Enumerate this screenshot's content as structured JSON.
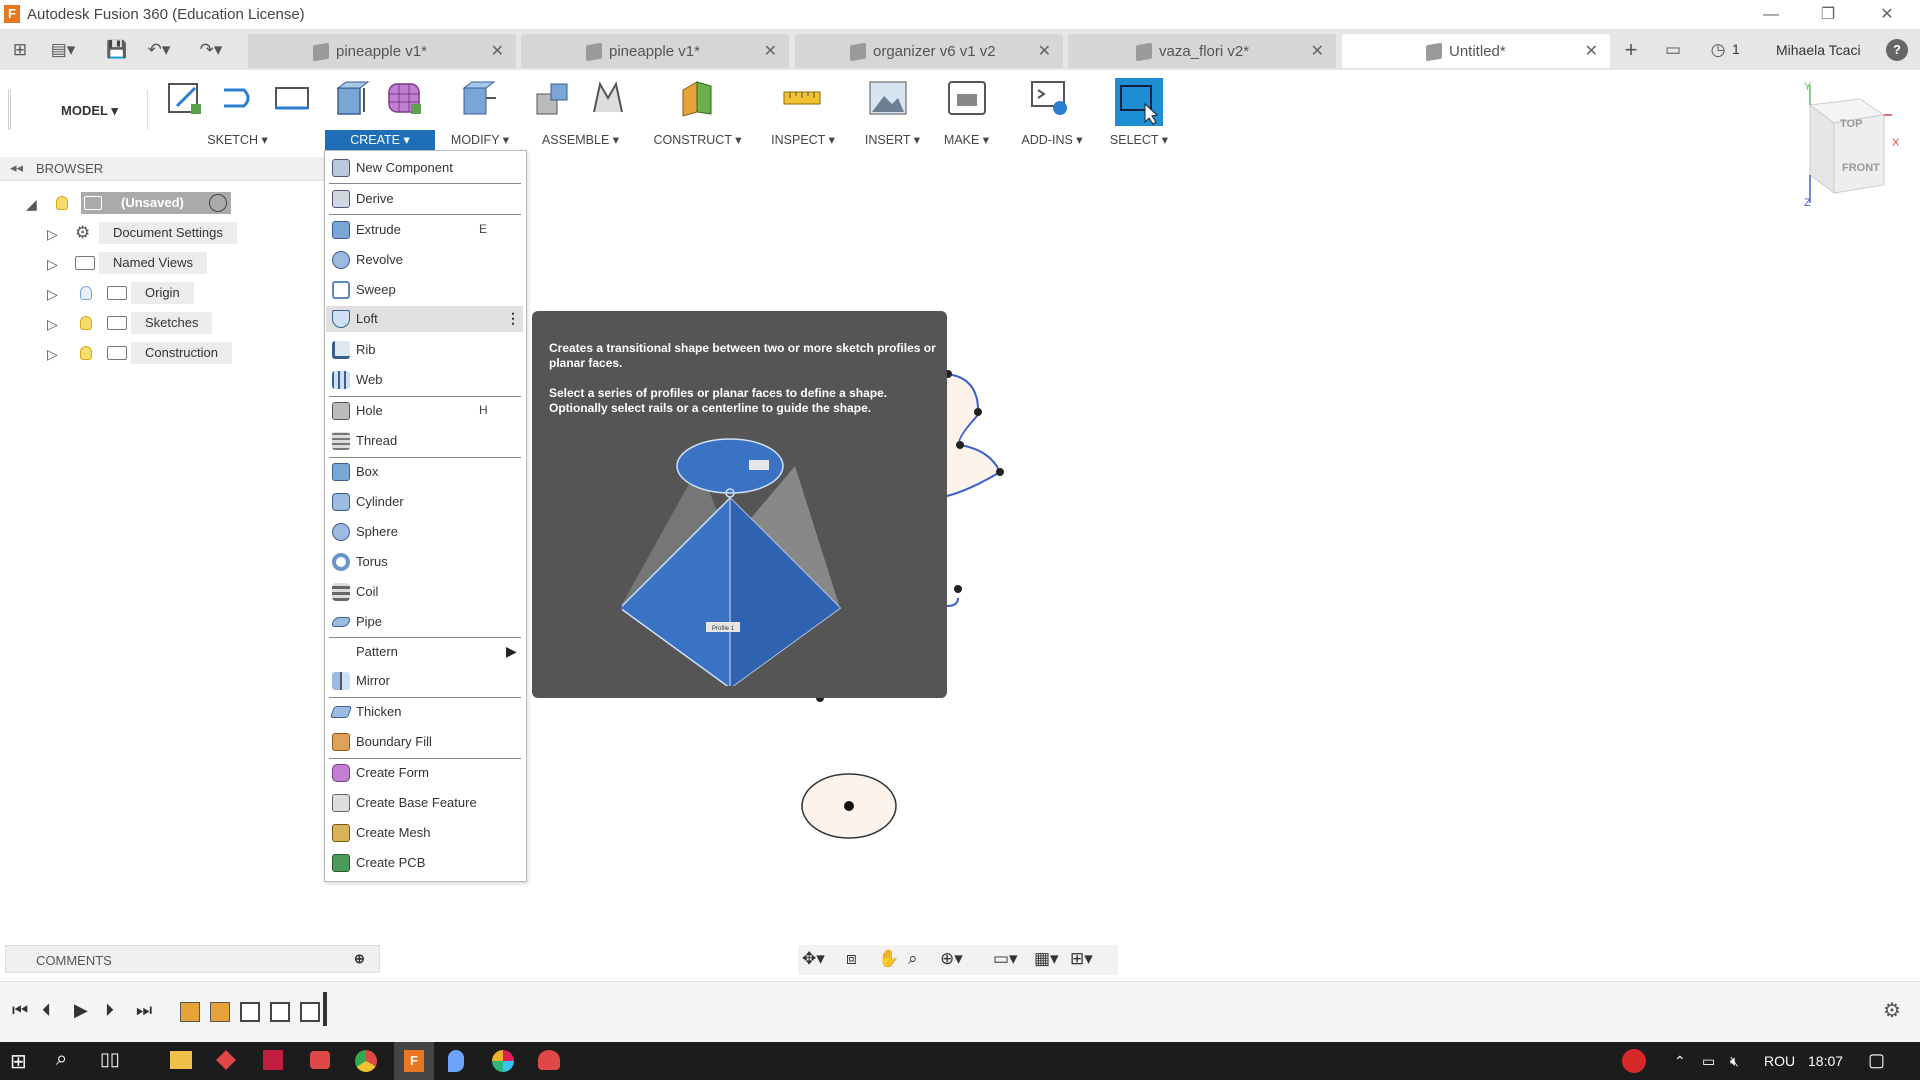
{
  "window": {
    "title": "Autodesk Fusion 360 (Education License)",
    "logo_letter": "F"
  },
  "tabs": [
    {
      "label": "pineapple v1*",
      "active": false
    },
    {
      "label": "pineapple v1*",
      "active": false
    },
    {
      "label": "organizer v6 v1 v2",
      "active": false
    },
    {
      "label": "vaza_flori v2*",
      "active": false
    },
    {
      "label": "Untitled*",
      "active": true
    }
  ],
  "topbar": {
    "jobs_count": "1",
    "user_name": "Mihaela Tcaci"
  },
  "toolbar": {
    "workspace": "MODEL ▾",
    "groups": [
      "SKETCH ▾",
      "CREATE ▾",
      "MODIFY ▾",
      "ASSEMBLE ▾",
      "CONSTRUCT ▾",
      "INSPECT ▾",
      "INSERT ▾",
      "MAKE ▾",
      "ADD-INS ▾",
      "SELECT ▾"
    ]
  },
  "browser": {
    "title": "BROWSER",
    "root": "(Unsaved)",
    "items": [
      "Document Settings",
      "Named Views",
      "Origin",
      "Sketches",
      "Construction"
    ]
  },
  "create_menu": {
    "items": [
      {
        "label": "New Component",
        "key": ""
      },
      {
        "label": "Derive",
        "key": ""
      },
      {
        "label": "Extrude",
        "key": "E"
      },
      {
        "label": "Revolve",
        "key": ""
      },
      {
        "label": "Sweep",
        "key": ""
      },
      {
        "label": "Loft",
        "key": ""
      },
      {
        "label": "Rib",
        "key": ""
      },
      {
        "label": "Web",
        "key": ""
      },
      {
        "label": "Hole",
        "key": "H"
      },
      {
        "label": "Thread",
        "key": ""
      },
      {
        "label": "Box",
        "key": ""
      },
      {
        "label": "Cylinder",
        "key": ""
      },
      {
        "label": "Sphere",
        "key": ""
      },
      {
        "label": "Torus",
        "key": ""
      },
      {
        "label": "Coil",
        "key": ""
      },
      {
        "label": "Pipe",
        "key": ""
      },
      {
        "label": "Pattern",
        "key": ""
      },
      {
        "label": "Mirror",
        "key": ""
      },
      {
        "label": "Thicken",
        "key": ""
      },
      {
        "label": "Boundary Fill",
        "key": ""
      },
      {
        "label": "Create Form",
        "key": ""
      },
      {
        "label": "Create Base Feature",
        "key": ""
      },
      {
        "label": "Create Mesh",
        "key": ""
      },
      {
        "label": "Create PCB",
        "key": ""
      }
    ]
  },
  "tooltip": {
    "line1": "Creates a transitional shape between two or more sketch profiles or planar faces.",
    "line2": "Select a series of profiles or planar faces to define a shape. Optionally select rails or a centerline to guide the shape.",
    "profile_label": "Profile 1"
  },
  "viewcube": {
    "top": "TOP",
    "front": "FRONT",
    "y": "Y",
    "x": "X",
    "z": "Z"
  },
  "comments": {
    "title": "COMMENTS"
  },
  "taskbar": {
    "lang": "ROU",
    "time": "18:07"
  },
  "colors": {
    "accent": "#1e6fb8",
    "tooltip_bg": "#555555",
    "loft_blue": "#3a72c4"
  }
}
